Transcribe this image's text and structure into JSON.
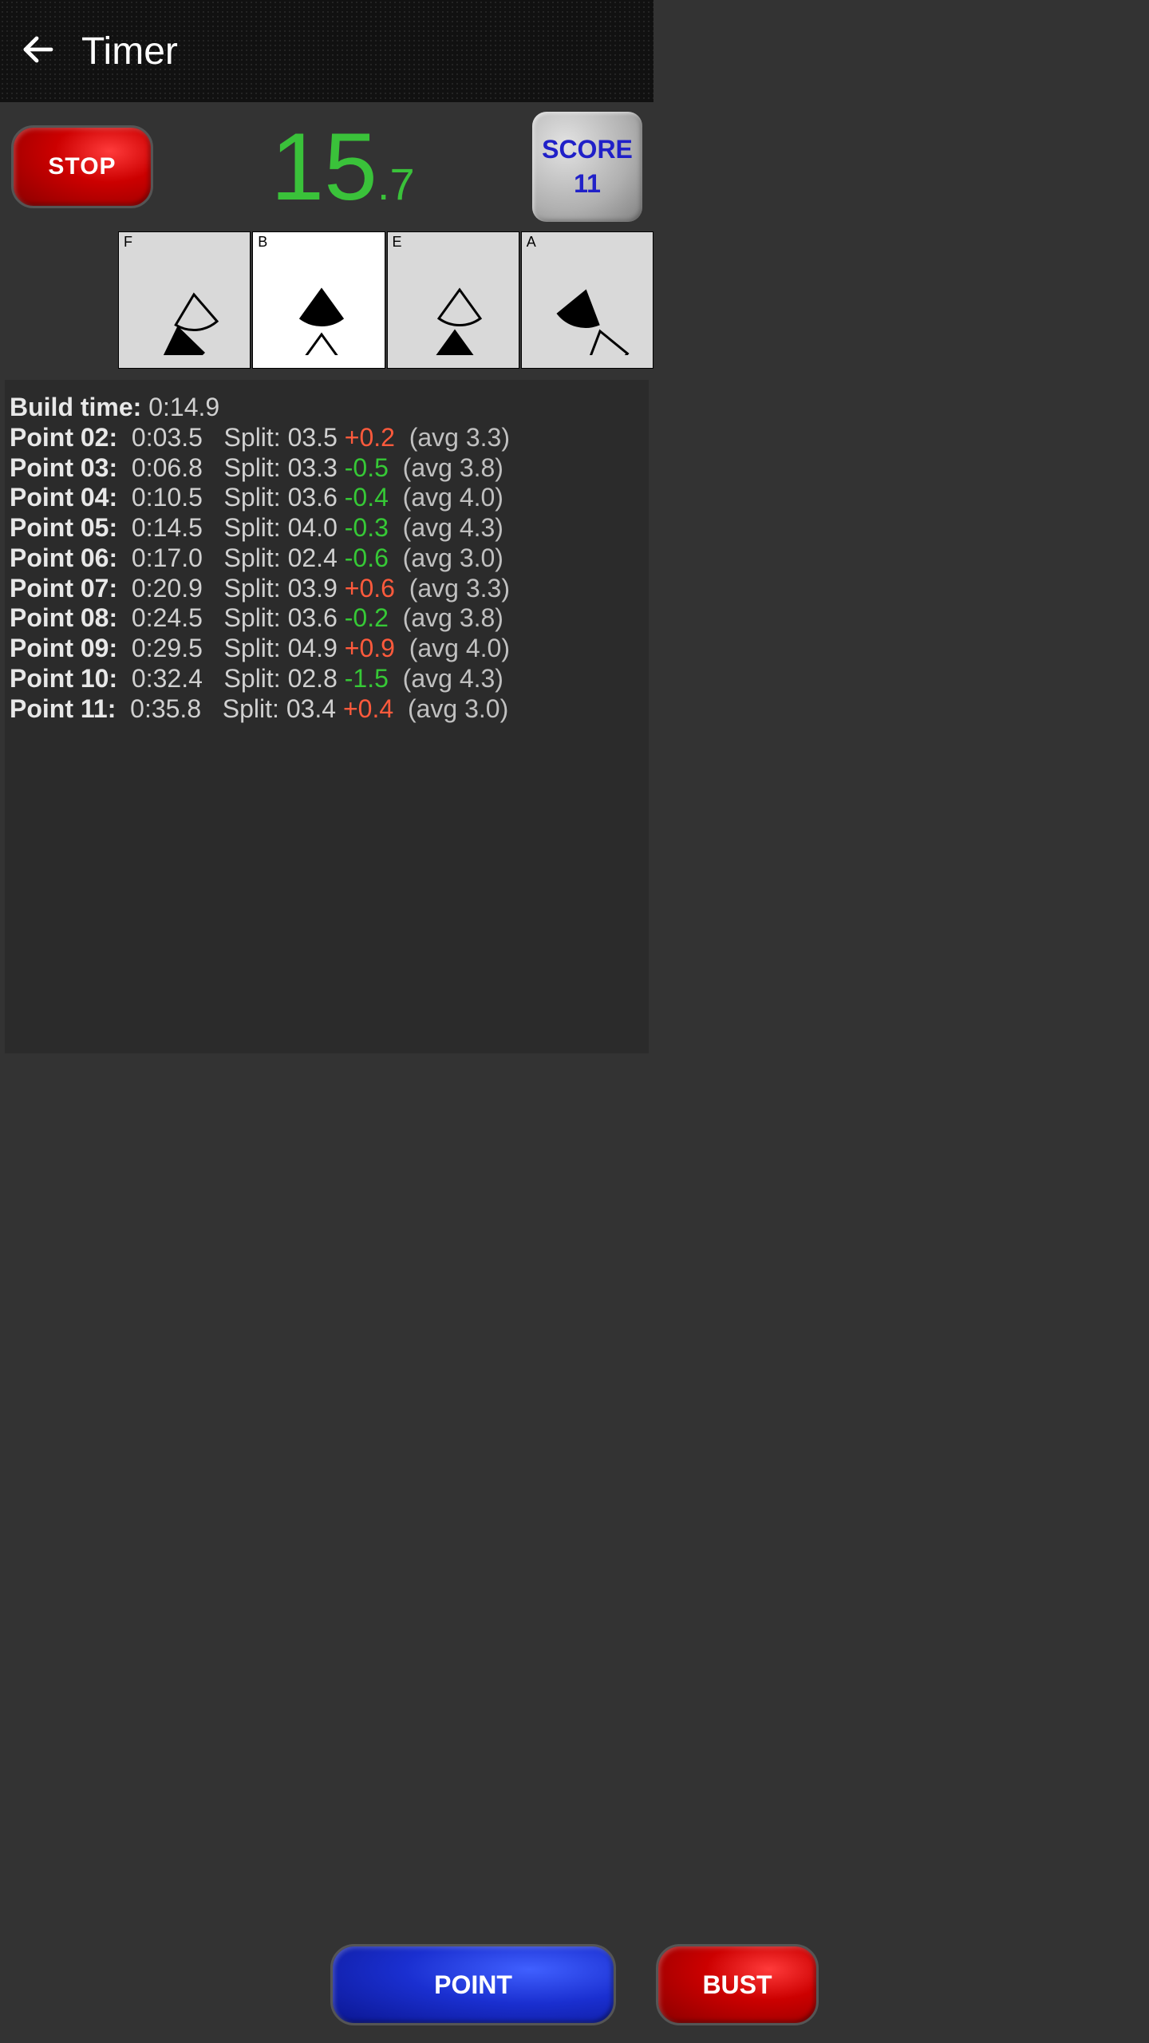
{
  "header": {
    "title": "Timer"
  },
  "top": {
    "stop_label": "STOP",
    "timer_int": "15",
    "timer_frac": ".7",
    "score_label_line1": "SCORE",
    "score_label_line2": "11"
  },
  "cards": [
    {
      "letter": "F",
      "active": false
    },
    {
      "letter": "B",
      "active": true
    },
    {
      "letter": "E",
      "active": false
    },
    {
      "letter": "A",
      "active": false
    }
  ],
  "log": {
    "build_label": "Build time:",
    "build_value": "0:14.9",
    "rows": [
      {
        "label": "Point 02:",
        "time": "0:03.5",
        "split": "03.5",
        "delta": "+0.2",
        "delta_sign": "pos",
        "avg": "(avg 3.3)"
      },
      {
        "label": "Point 03:",
        "time": "0:06.8",
        "split": "03.3",
        "delta": "-0.5",
        "delta_sign": "neg",
        "avg": "(avg 3.8)"
      },
      {
        "label": "Point 04:",
        "time": "0:10.5",
        "split": "03.6",
        "delta": "-0.4",
        "delta_sign": "neg",
        "avg": "(avg 4.0)"
      },
      {
        "label": "Point 05:",
        "time": "0:14.5",
        "split": "04.0",
        "delta": "-0.3",
        "delta_sign": "neg",
        "avg": "(avg 4.3)"
      },
      {
        "label": "Point 06:",
        "time": "0:17.0",
        "split": "02.4",
        "delta": "-0.6",
        "delta_sign": "neg",
        "avg": "(avg 3.0)"
      },
      {
        "label": "Point 07:",
        "time": "0:20.9",
        "split": "03.9",
        "delta": "+0.6",
        "delta_sign": "pos",
        "avg": "(avg 3.3)"
      },
      {
        "label": "Point 08:",
        "time": "0:24.5",
        "split": "03.6",
        "delta": "-0.2",
        "delta_sign": "neg",
        "avg": "(avg 3.8)"
      },
      {
        "label": "Point 09:",
        "time": "0:29.5",
        "split": "04.9",
        "delta": "+0.9",
        "delta_sign": "pos",
        "avg": "(avg 4.0)"
      },
      {
        "label": "Point 10:",
        "time": "0:32.4",
        "split": "02.8",
        "delta": "-1.5",
        "delta_sign": "neg",
        "avg": "(avg 4.3)"
      },
      {
        "label": "Point 11:",
        "time": "0:35.8",
        "split": "03.4",
        "delta": "+0.4",
        "delta_sign": "pos",
        "avg": "(avg 3.0)"
      }
    ],
    "split_word": "Split:"
  },
  "bottom": {
    "point_label": "POINT",
    "bust_label": "BUST"
  }
}
